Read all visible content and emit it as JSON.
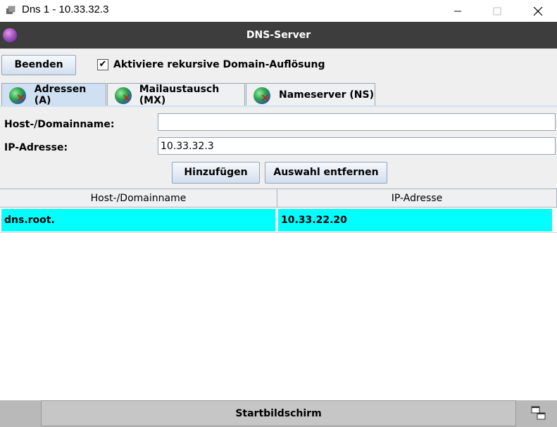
{
  "window": {
    "title": "Dns 1 - 10.33.32.3",
    "minimize_glyph": "—",
    "maximize_glyph": "☐",
    "close_glyph": "✕"
  },
  "app": {
    "title": "DNS-Server",
    "icon_label": "DNS"
  },
  "toolbar": {
    "quit_label": "Beenden",
    "recursive_label": "Aktiviere rekursive Domain-Auflösung",
    "recursive_checked": true
  },
  "tabs": [
    {
      "label": "Adressen (A)",
      "active": true
    },
    {
      "label": "Mailaustausch (MX)",
      "active": false
    },
    {
      "label": "Nameserver (NS)",
      "active": false
    }
  ],
  "form": {
    "host_label": "Host-/Domainname:",
    "host_value": "",
    "ip_label": "IP-Adresse:",
    "ip_value": "10.33.32.3",
    "add_label": "Hinzufügen",
    "remove_label": "Auswahl entfernen"
  },
  "table": {
    "headers": [
      "Host-/Domainname",
      "IP-Adresse"
    ],
    "rows": [
      {
        "host": "dns.root.",
        "ip": "10.33.22.20",
        "selected": true
      }
    ]
  },
  "footer": {
    "start_label": "Startbildschirm"
  },
  "colors": {
    "header_bg": "#3d3d3d",
    "selection": "#00ffff",
    "tab_active": "#cfe0f3"
  }
}
